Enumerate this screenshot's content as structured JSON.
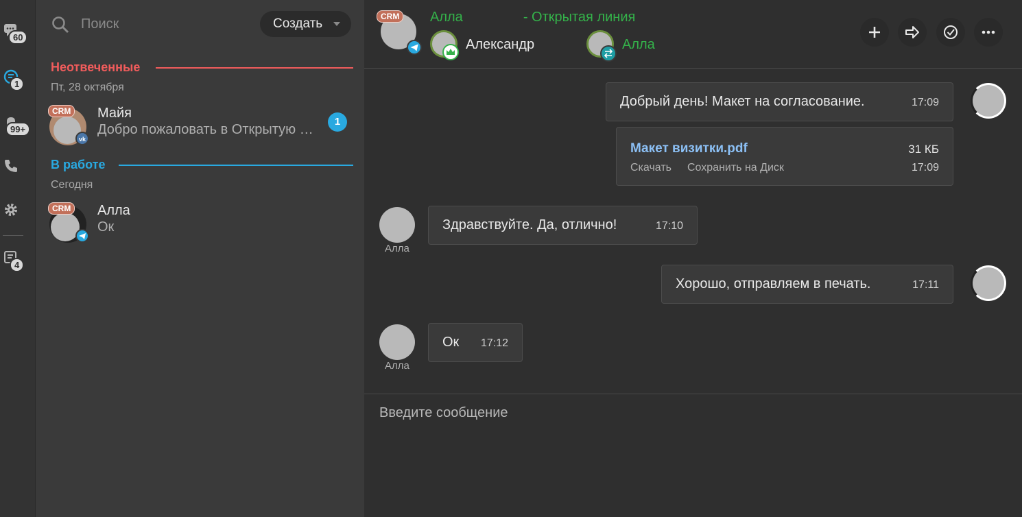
{
  "colors": {
    "accent_green": "#34b24a",
    "unanswered_red": "#f15c5c",
    "in_work_blue": "#29a9e0",
    "crm_tag": "#c2705a",
    "file_link": "#8cc0f5"
  },
  "rail": {
    "items": [
      {
        "icon": "chat-bubble-icon",
        "badge": "60"
      },
      {
        "icon": "open-lines-icon",
        "badge": "1"
      },
      {
        "icon": "notifications-icon",
        "badge": "99+"
      },
      {
        "icon": "phone-icon",
        "badge": ""
      },
      {
        "icon": "gear-icon",
        "badge": ""
      },
      {
        "icon": "tasks-icon",
        "badge": "4"
      }
    ]
  },
  "list": {
    "search_placeholder": "Поиск",
    "create_label": "Создать",
    "groups": [
      {
        "title": "Неотвеченные",
        "date": "Пт, 28 октября",
        "chats": [
          {
            "name": "Майя",
            "last": "Добро пожаловать в Открытую …",
            "crm": "CRM",
            "network": "vk-icon",
            "unread": "1"
          }
        ]
      },
      {
        "title": "В работе",
        "date": "Сегодня",
        "chats": [
          {
            "name": "Алла",
            "last": "Ок",
            "crm": "CRM",
            "network": "telegram-icon",
            "unread": ""
          }
        ]
      }
    ]
  },
  "header": {
    "crm": "CRM",
    "title_name": "Алла",
    "title_suffix": "- Открытая линия",
    "members": [
      {
        "name": "Александр",
        "role_icon": "crown-icon"
      },
      {
        "name": "Алла",
        "role_icon": "transfer-icon"
      }
    ],
    "actions": [
      "add-icon",
      "forward-icon",
      "check-circle-icon",
      "more-icon"
    ]
  },
  "messages": [
    {
      "text": "Добрый день! Макет на согласование.",
      "time": "17:09",
      "own": true
    },
    {
      "file": "Макет визитки.pdf",
      "size": "31 КБ",
      "download": "Скачать",
      "save": "Сохранить на Диск",
      "time": "17:09",
      "own": true
    },
    {
      "text": "Здравствуйте. Да, отлично!",
      "time": "17:10",
      "own": false,
      "author": "Алла"
    },
    {
      "text": "Хорошо, отправляем в печать.",
      "time": "17:11",
      "own": true
    },
    {
      "text": "Ок",
      "time": "17:12",
      "own": false,
      "author": "Алла"
    }
  ],
  "composer": {
    "placeholder": "Введите сообщение"
  }
}
